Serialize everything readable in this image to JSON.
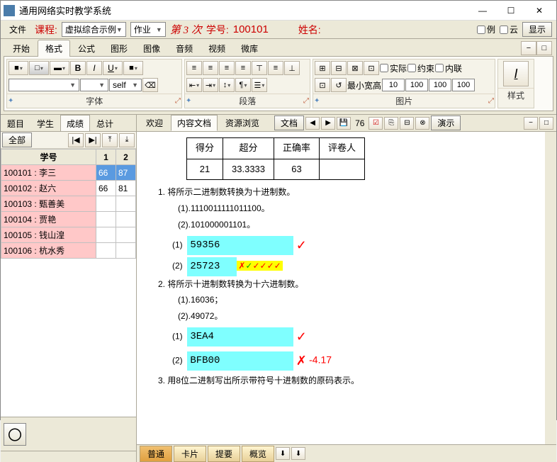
{
  "window": {
    "title": "通用网络实时教学系统"
  },
  "menubar": {
    "file": "文件",
    "course_label": "课程:",
    "course_value": "虚拟综合示例",
    "hw": "作业",
    "attempt": "第 3 次",
    "sid_label": "学号:",
    "sid_value": "100101",
    "name_label": "姓名:",
    "chk1": "例",
    "chk2": "云",
    "show": "显示"
  },
  "ribbon": {
    "tabs": [
      "开始",
      "格式",
      "公式",
      "图形",
      "图像",
      "音频",
      "视频",
      "微库"
    ],
    "active": 1,
    "groups": {
      "font": "字体",
      "para": "段落",
      "pic": "图片",
      "style": "样式"
    },
    "self": "self",
    "real": "实际",
    "constrain": "约束",
    "inline": "内联",
    "minwh": "最小宽高",
    "w": "10",
    "h": "100",
    "w2": "100",
    "h2": "100",
    "stylebtn": "I"
  },
  "left": {
    "tabs": [
      "题目",
      "学生",
      "成绩",
      "总计"
    ],
    "active": 2,
    "all": "全部",
    "header": {
      "id": "学号",
      "c1": "1",
      "c2": "2"
    },
    "rows": [
      {
        "id": "100101",
        "name": "李三",
        "c1": "66",
        "c2": "87",
        "sel": true
      },
      {
        "id": "100102",
        "name": "赵六",
        "c1": "66",
        "c2": "81"
      },
      {
        "id": "100103",
        "name": "甄善美",
        "c1": "",
        "c2": ""
      },
      {
        "id": "100104",
        "name": "贾艳",
        "c1": "",
        "c2": ""
      },
      {
        "id": "100105",
        "name": "钱山湟",
        "c1": "",
        "c2": ""
      },
      {
        "id": "100106",
        "name": "杭水秀",
        "c1": "",
        "c2": ""
      }
    ]
  },
  "doc": {
    "tabs": [
      "欢迎",
      "内容文档",
      "资源浏览"
    ],
    "active": 1,
    "toolbar": {
      "archive": "文档",
      "count": "76",
      "present": "演示"
    },
    "scoretbl": {
      "h": [
        "得分",
        "超分",
        "正确率",
        "评卷人"
      ],
      "r": [
        "21",
        "33.3333",
        "63",
        ""
      ]
    },
    "q1": "1.  将所示二进制数转换为十进制数。",
    "q1a": "(1).1110011111011100。",
    "q1b": "(2).101000001101。",
    "a1n": "(1)",
    "a1v": "59356",
    "a2n": "(2)",
    "a2v": "25723",
    "q2": "2.  将所示十进制数转换为十六进制数。",
    "q2a": "(1).16036；",
    "q2b": "(2).49072。",
    "a3n": "(1)",
    "a3v": "3EA4",
    "a4n": "(2)",
    "a4v": "BFB00",
    "a4score": "-4.17",
    "q3": "3.  用8位二进制写出所示带符号十进制数的原码表示。"
  },
  "bottom": {
    "tabs": [
      "普通",
      "卡片",
      "提要",
      "概览"
    ],
    "active": 0
  }
}
